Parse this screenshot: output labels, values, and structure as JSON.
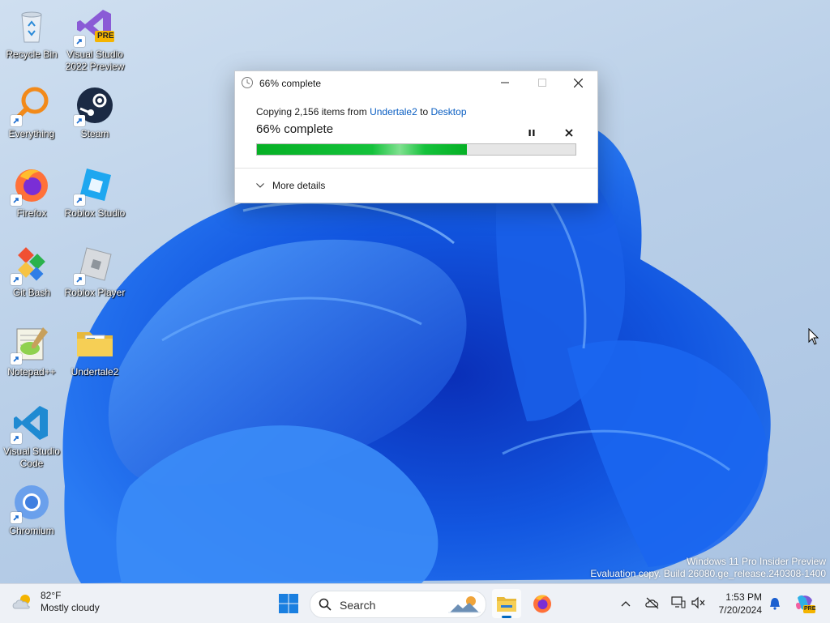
{
  "desktop": {
    "icons": [
      {
        "label": "Recycle Bin"
      },
      {
        "label": "Visual Studio 2022 Preview",
        "badge": "PRE"
      },
      {
        "label": "Everything"
      },
      {
        "label": "Steam"
      },
      {
        "label": "Firefox"
      },
      {
        "label": "Roblox Studio"
      },
      {
        "label": "Git Bash"
      },
      {
        "label": "Roblox Player"
      },
      {
        "label": "Notepad++"
      },
      {
        "label": "Undertale2"
      },
      {
        "label": "Visual Studio Code"
      },
      {
        "label": "Chromium"
      }
    ]
  },
  "dialog": {
    "title": "66% complete",
    "copy_prefix": "Copying 2,156 items from ",
    "source": "Undertale2",
    "to_word": " to ",
    "destination": "Desktop",
    "percent_text": "66% complete",
    "progress": 0.66,
    "more_details": "More details",
    "accent": "#06b025"
  },
  "watermark": {
    "line1": "Windows 11 Pro Insider Preview",
    "line2": "Evaluation copy. Build 26080.ge_release.240308-1400"
  },
  "taskbar": {
    "weather_temp": "82°F",
    "weather_desc": "Mostly cloudy",
    "search_placeholder": "Search",
    "time": "1:53 PM",
    "date": "7/20/2024",
    "copilot_badge": "PRE"
  }
}
